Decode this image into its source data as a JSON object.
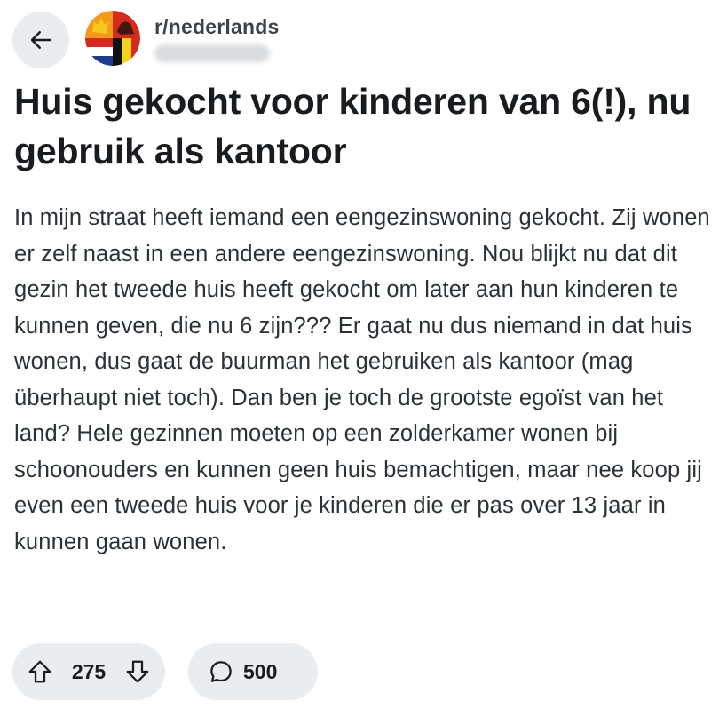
{
  "header": {
    "back_icon": "arrow-left-icon",
    "subreddit": "r/nederlands",
    "subreddit_avatar_colors": {
      "orange": "#f39a1e",
      "red": "#d52b1e",
      "yellow": "#f7d117",
      "blue": "#1e3c8c",
      "white": "#ffffff",
      "black": "#111111"
    }
  },
  "post": {
    "title": "Huis gekocht voor kinderen van 6(!), nu gebruik als kantoor",
    "body": "In mijn straat heeft iemand een eengezinswoning gekocht. Zij wonen er zelf naast in een andere eengezinswoning. Nou blijkt nu dat dit gezin het tweede huis heeft gekocht om later aan hun kinderen te kunnen geven, die nu 6 zijn??? Er gaat nu dus niemand in dat huis wonen, dus gaat de buurman het gebruiken als kantoor (mag überhaupt niet toch). Dan ben je toch de grootste egoïst van het land? Hele gezinnen moeten op een zolderkamer wonen bij schoonouders en kunnen geen huis bemachtigen, maar nee koop jij even een tweede huis voor je kinderen die er pas over 13 jaar in kunnen gaan wonen."
  },
  "actions": {
    "vote_count": "275",
    "comment_count": "500",
    "upvote_icon": "upvote-arrow-icon",
    "downvote_icon": "downvote-arrow-icon",
    "comment_icon": "comment-bubble-icon"
  },
  "colors": {
    "pill_background": "#eaedef",
    "text_primary": "#181c1f",
    "text_body": "#2a3236",
    "subreddit_name": "#3d4447"
  }
}
